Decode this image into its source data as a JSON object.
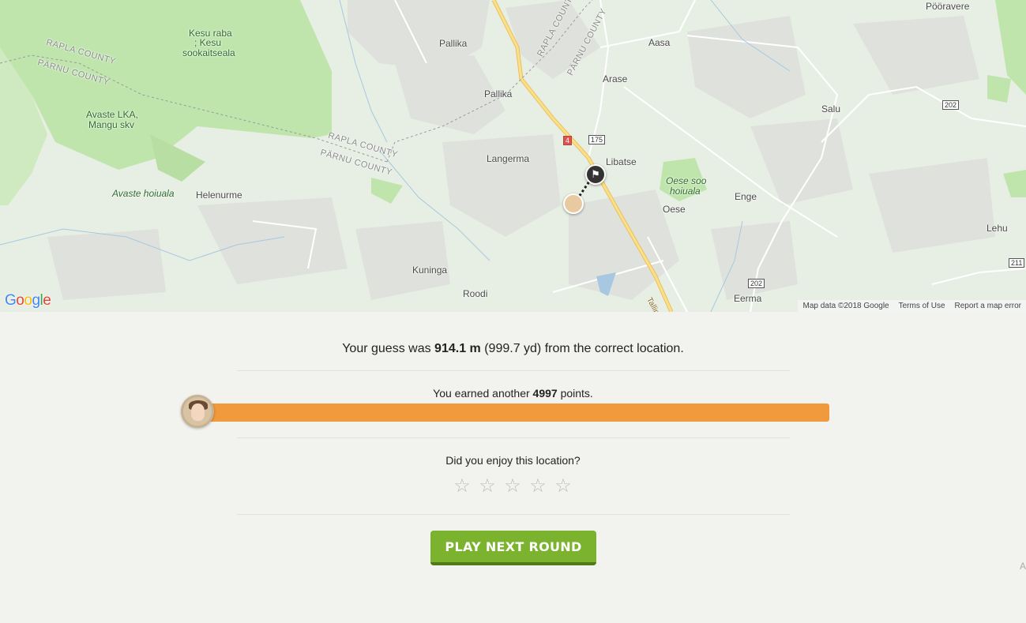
{
  "map": {
    "places": [
      "Pööravere",
      "Pallika",
      "Aasa",
      "Kesu raba",
      "; Kesu",
      "sookaitseala",
      "Arase",
      "Pallika",
      "Salu",
      "Avaste LKA,",
      "Mangu skv",
      "Libatse",
      "Langerma",
      "Oesе soo",
      "hoiuala",
      "Enge",
      "Avaste hoiuala",
      "Helenurme",
      "Oese",
      "Lehu",
      "Kuninga",
      "Roodi",
      "Eerma",
      "Tallinn"
    ],
    "counties": [
      "RAPLA COUNTY",
      "PÄRNU COUNTY",
      "RAPLA COUNTY",
      "PÄRNU COUNTY",
      "RAPLA COUNTY",
      "PÄRNU COUNTY"
    ],
    "shields": [
      "4",
      "175",
      "202",
      "202",
      "211"
    ],
    "logo": "Google",
    "attribution": {
      "data": "Map data ©2018 Google",
      "terms": "Terms of Use",
      "report": "Report a map error"
    },
    "flag_icon": "flag-icon",
    "guess_icon": "avatar-icon"
  },
  "result": {
    "distance_prefix": "Your guess was",
    "distance_value": "914.1 m",
    "distance_suffix": "(999.7 yd) from the correct location.",
    "points_prefix": "You earned another",
    "points_value": "4997",
    "points_suffix": "points.",
    "score_fraction": 0.9994,
    "enjoy_question": "Did you enjoy this location?",
    "stars": [
      "☆",
      "☆",
      "☆",
      "☆",
      "☆"
    ],
    "play_button": "PLAY NEXT ROUND",
    "edge": "A"
  },
  "colors": {
    "bar": "#f0993d",
    "button": "#7bb32e",
    "button_shadow": "#4f7a16",
    "map_green": "#c4e7b0"
  }
}
